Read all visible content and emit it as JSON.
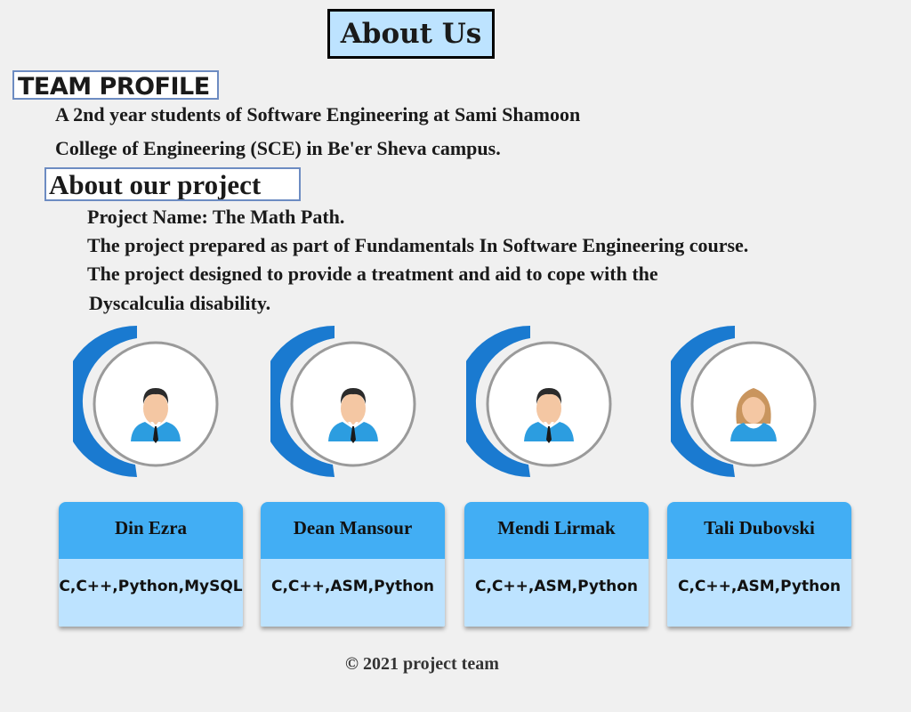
{
  "header": {
    "title": "About Us"
  },
  "team_profile": {
    "heading": "TEAM PROFILE",
    "line1": "A 2nd year students of Software Engineering at Sami Shamoon",
    "line2": "College of Engineering (SCE) in Be'er Sheva campus."
  },
  "project": {
    "heading": "About our project",
    "name_label": "Project Name:",
    "name_value": "The Math Path.",
    "line1": "The project prepared as part of Fundamentals In Software Engineering course.",
    "line2": "The project designed to provide a treatment and aid to cope with the",
    "line3": "Dyscalculia disability."
  },
  "team": [
    {
      "name": "Din Ezra",
      "skills": "C,C++,Python,MySQL",
      "avatar": "male-avatar-icon"
    },
    {
      "name": "Dean Mansour",
      "skills": "C,C++,ASM,Python",
      "avatar": "male-avatar-icon"
    },
    {
      "name": "Mendi Lirmak",
      "skills": "C,C++,ASM,Python",
      "avatar": "male-avatar-icon"
    },
    {
      "name": "Tali Dubovski",
      "skills": "C,C++,ASM,Python",
      "avatar": "female-avatar-icon"
    }
  ],
  "footer": {
    "text": "© 2021 project team"
  },
  "colors": {
    "accent": "#1a7ad0",
    "card_header": "#42aef4",
    "card_body": "#bde3ff",
    "title_bg": "#bde3ff"
  }
}
